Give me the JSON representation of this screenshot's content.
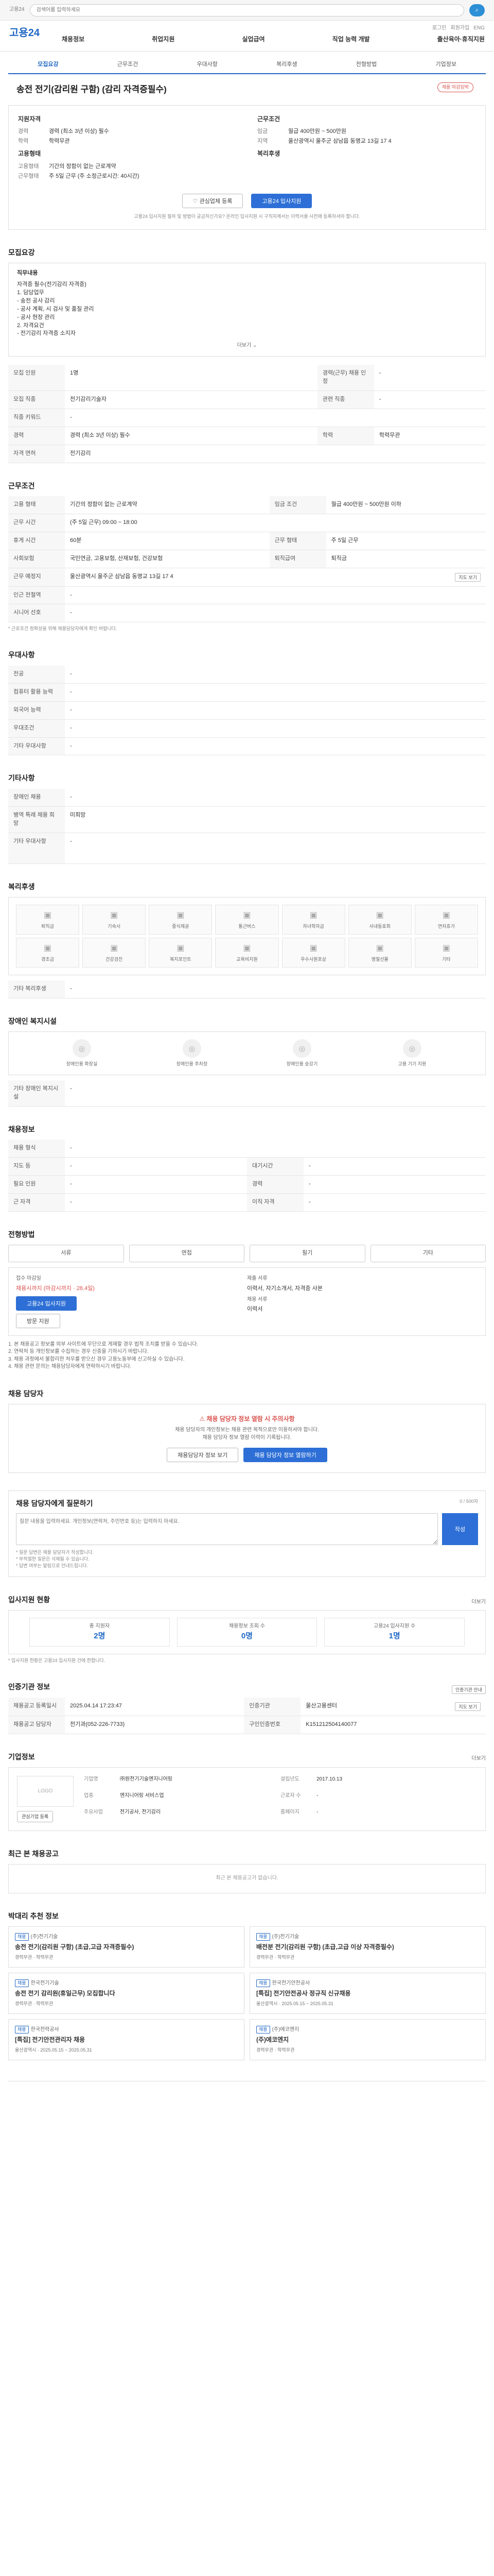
{
  "topbar": {
    "label": "고용24",
    "search_placeholder": "검색어를 입력하세요",
    "search_btn": "검색"
  },
  "header": {
    "logo": "고용24",
    "links": [
      "로그인",
      "회원가입",
      "ENG"
    ],
    "nav": [
      "채용정보",
      "취업지원",
      "실업급여",
      "직업 능력 개발",
      "출산육아·휴직지원"
    ]
  },
  "tabs": [
    "모집요강",
    "근무조건",
    "우대사항",
    "복리후생",
    "전형방법",
    "기업정보"
  ],
  "job": {
    "title": "송전 전기(감리원 구함) (감리 자격증필수)",
    "badge": "채용 마감임박",
    "recruit_title": "지원자격",
    "recruit": [
      {
        "k": "경력",
        "v": "경력 (최소 3년 이상) 필수"
      },
      {
        "k": "학력",
        "v": "학력무관"
      }
    ],
    "work_title": "근무조건",
    "work": [
      {
        "k": "임금",
        "v": "월급 400만원 ~ 500만원"
      },
      {
        "k": "지역",
        "v": "울산광역시 울주군 삼남읍 동명교 13길 17 4"
      }
    ],
    "form_title": "고용형태",
    "form": [
      {
        "k": "고용형태",
        "v": "기간의 정함이 없는 근로계약"
      },
      {
        "k": "근무형태",
        "v": "주 5일 근무 (주 소정근로시간: 40시간)"
      }
    ],
    "benefit_title": "복리후생"
  },
  "actions": {
    "interest": "관심업체 등록",
    "apply": "고용24 입사지원"
  },
  "notice": "고용24 입사지원 절차 및 방법이 궁금하신가요? 온라인 입사지원 시 구직자께서는 이력서를 사전에 등록하셔야 합니다.",
  "recruit_section": {
    "title": "모집요강",
    "content_label": "직무내용",
    "content": [
      "자격증 필수(전기감리 자격증)",
      "1. 담당업무",
      "- 송전 공사 감리",
      "- 공사 계획, 시 검사 및 품질 관리",
      "- 공사 현장 관리",
      "2. 자격요건",
      "- 전기감리 자격증 소지자"
    ],
    "more": "더보기",
    "rows": [
      {
        "k": "모집 인원",
        "v": "1명",
        "k2": "경력(근무) 채용 인정",
        "v2": "-"
      },
      {
        "k": "모집 직종",
        "v": "전기감리기술자",
        "k2": "관련 직종",
        "v2": "-"
      },
      {
        "k": "직종 키워드",
        "v": "-",
        "k2": "",
        "v2": ""
      },
      {
        "k": "경력",
        "v": "경력 (최소 3년 이상) 필수",
        "k2": "학력",
        "v2": "학력무관"
      },
      {
        "k": "자격 면허",
        "v": "전기감리",
        "k2": "",
        "v2": ""
      }
    ]
  },
  "work_section": {
    "title": "근무조건",
    "rows": [
      {
        "k": "고용 형태",
        "v": "기간의 정함이 없는 근로계약",
        "k2": "임금 조건",
        "v2": "월급 400만원 ~ 500만원 이하"
      },
      {
        "k": "근무 시간",
        "v": "(주 5일 근무) 09:00 ~ 18:00",
        "k2": "",
        "v2": ""
      },
      {
        "k": "휴게 시간",
        "v": "60분",
        "k2": "근무 형태",
        "v2": "주 5일 근무"
      },
      {
        "k": "사회보험",
        "v": "국민연금, 고용보험, 산재보험, 건강보험",
        "k2": "퇴직급여",
        "v2": "퇴직금"
      },
      {
        "k": "근무 예정지",
        "v": "울산광역시 울주군 삼남읍 동명교 13길 17 4",
        "k2": "",
        "v2": ""
      },
      {
        "k": "인근 전철역",
        "v": "-",
        "k2": "",
        "v2": ""
      },
      {
        "k": "시니어 선호",
        "v": "-",
        "k2": "",
        "v2": ""
      }
    ],
    "map_btn": "지도 보기",
    "note": "* 근로조건 정확성을 위해 채용담당자에게 확인 바랍니다."
  },
  "pref_section": {
    "title": "우대사항",
    "rows": [
      {
        "k": "전공",
        "v": "-"
      },
      {
        "k": "컴퓨터 활용 능력",
        "v": "-"
      },
      {
        "k": "외국어 능력",
        "v": "-"
      },
      {
        "k": "우대조건",
        "v": "-"
      },
      {
        "k": "기타 우대사항",
        "v": "-"
      }
    ]
  },
  "etc_section": {
    "title": "기타사항",
    "rows": [
      {
        "k": "장애인 채용",
        "v": "-"
      },
      {
        "k": "병역 특례 채용 희망",
        "v": "미희망"
      },
      {
        "k": "기타 우대사항",
        "v": "-"
      }
    ],
    "more": "더보기"
  },
  "benefit_section": {
    "title": "복리후생",
    "items": [
      "퇴직금",
      "기숙사",
      "중식제공",
      "통근버스",
      "자녀학자금",
      "사내동호회",
      "연차휴가",
      "경조금",
      "건강검진",
      "복지포인트",
      "교육비지원",
      "우수사원포상",
      "명절선물",
      "기타"
    ],
    "etc_title": "기타 복리후생",
    "etc": "-"
  },
  "welfare_section": {
    "title": "장애인 복지시설",
    "items": [
      "장애인용 화장실",
      "장애인용 주차장",
      "장애인용 승강기",
      "고용 기기 지원"
    ],
    "etc_title": "기타 장애인 복지시설",
    "etc": "-"
  },
  "labor_section": {
    "title": "채용정보",
    "rows": [
      {
        "k": "채용 형식",
        "v": "-",
        "k2": "",
        "v2": ""
      },
      {
        "k": "지도 등",
        "v": "-",
        "k2": "대기시간",
        "v2": "-"
      },
      {
        "k": "필요 인원",
        "v": "-",
        "k2": "경력",
        "v2": "-"
      },
      {
        "k": "근 자격",
        "v": "-",
        "k2": "이직 자격",
        "v2": "-"
      }
    ]
  },
  "process_section": {
    "title": "전형방법",
    "methods": [
      "서류",
      "면접",
      "필기",
      "기타"
    ],
    "apply_label": "접수 마감일",
    "apply_value": "채용시까지 (마감시까지 · 28.4일)",
    "apply_btn": "고용24 입사지원",
    "apply_btn2": "방문 지원",
    "docs_label": "제출 서류",
    "docs_value": "이력서, 자기소개서, 자격증 사본",
    "method_label": "채용 서류",
    "method_value": "이력서",
    "notes": [
      "1. 본 채용공고 정보를 외부 사이트에 무단으로 게재할 경우 법적 조치를 받을 수 있습니다.",
      "2. 연락처 등 개인정보를 수집하는 경우 신중을 기하시기 바랍니다.",
      "3. 채용 과정에서 불합리한 처우를 받으신 경우 고용노동부에 신고하실 수 있습니다.",
      "4. 채용 관련 문의는 채용담당자에게 연락하시기 바랍니다."
    ]
  },
  "manager_section": {
    "title": "채용 담당자",
    "warn": "채용 담당자 정보 열람 시 주의사항",
    "desc": "채용 담당자의 개인정보는 채용 관련 목적으로만 이용하셔야 합니다.",
    "desc2": "채용 담당자 정보 열람 이력이 기록됩니다.",
    "btn1": "채용담당자 정보 보기",
    "btn2": "채용 담당자 정보 열람하기"
  },
  "qna_section": {
    "title": "채용 담당자에게 질문하기",
    "placeholder": "질문 내용을 입력하세요. 개인정보(연락처, 주민번호 등)는 입력하지 마세요.",
    "btn": "작성",
    "count": "0 / 500자",
    "notes": [
      "* 질문 답변은 채용 담당자가 작성합니다.",
      "* 부적절한 질문은 삭제될 수 있습니다.",
      "* 답변 여부는 알림으로 안내드립니다."
    ]
  },
  "stats_section": {
    "title": "입사지원 현황",
    "more": "더보기",
    "items": [
      {
        "label": "총 지원자",
        "value": "2명"
      },
      {
        "label": "채용정보 조회 수",
        "value": "0명"
      },
      {
        "label": "고용24 입사지원 수",
        "value": "1명"
      }
    ],
    "note": "* 입사지원 현황은 고용24 입사지원 건에 한합니다."
  },
  "info_section": {
    "title": "인증기관 정보",
    "btn": "인증기관 안내",
    "rows": [
      {
        "k": "채용공고 등록일시",
        "v": "2025.04.14 17:23:47",
        "k2": "인증기관",
        "v2": "울산고용센터"
      },
      {
        "k": "채용공고 담당자",
        "v": "전기과(052-226-7733)",
        "k2": "구인인증번호",
        "v2": "K151212504140077"
      }
    ],
    "btn2": "지도 보기"
  },
  "company_section": {
    "title": "기업정보",
    "more": "더보기",
    "logo": "LOGO",
    "rows": [
      {
        "k": "기업명",
        "v": "㈜원전기기술엔지니어링",
        "k2": "설립년도",
        "v2": "2017.10.13"
      },
      {
        "k": "업종",
        "v": "엔지니어링 서비스업",
        "k2": "근로자 수",
        "v2": "-"
      },
      {
        "k": "주요사업",
        "v": "전기공사, 전기감리",
        "k2": "홈페이지",
        "v2": "-"
      }
    ],
    "btn": "관심기업 등록"
  },
  "recent_section": {
    "title": "최근 본 채용공고",
    "empty": "최근 본 채용공고가 없습니다."
  },
  "rec_section": {
    "title": "박대리 추천 정보",
    "cards": [
      {
        "tag": "채용",
        "co": "(주)전기기술",
        "title": "송전 전기(감리원 구함) (초급,고급 자격증필수)",
        "meta": "경력무관 · 학력무관"
      },
      {
        "tag": "채용",
        "co": "(주)전기기술",
        "title": "배전분 전기(감리원 구함) (초급,고급 이상 자격증필수)",
        "meta": "경력무관 · 학력무관"
      },
      {
        "tag": "채용",
        "co": "한국전기기술",
        "title": "송전 전기 감리원(휴일근무) 모집합니다",
        "meta": "경력무관 · 학력무관"
      },
      {
        "tag": "채용",
        "co": "한국전기안전공사",
        "title": "[특집] 전기안전공사 정규직 신규채용",
        "meta": "울산광역시 · 2025.05.15 ~ 2025.05.31"
      },
      {
        "tag": "채용",
        "co": "한국전력공사",
        "title": "[특집] 전기안전관리자 채용",
        "meta": "울산광역시 · 2025.05.15 ~ 2025.05.31"
      },
      {
        "tag": "채용",
        "co": "(주)에코엔지",
        "title": "(주)에코엔지",
        "meta": "경력무관 · 학력무관"
      }
    ]
  }
}
